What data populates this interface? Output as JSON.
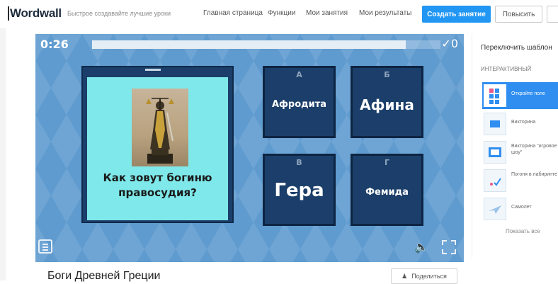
{
  "header": {
    "logo": "Wordwall",
    "tagline": "Быстрое создавайте лучшие уроки",
    "nav": [
      "Главная страница",
      "Функции",
      "Мои занятия",
      "Мои результаты"
    ],
    "create_button": "Создать занятие",
    "upgrade_button": "Повысить"
  },
  "game": {
    "timer": "0:26",
    "score": "✓0",
    "progress_fraction": 0.9,
    "question": "Как зовут богиню правосудия?",
    "answers": [
      {
        "letter": "А",
        "text": "Афродита"
      },
      {
        "letter": "Б",
        "text": "Афина"
      },
      {
        "letter": "В",
        "text": "Гера"
      },
      {
        "letter": "Г",
        "text": "Фемида"
      }
    ],
    "sound_icon": "speaker-icon",
    "fullscreen_icon": "fullscreen-icon",
    "menu_icon": "menu-icon"
  },
  "panel": {
    "title": "Переключить шаблон",
    "section": "ИНТЕРАКТИВНЫЙ",
    "templates": [
      {
        "label": "Откройте поле",
        "active": true
      },
      {
        "label": "Викторина",
        "active": false
      },
      {
        "label": "Викторина \"игровое шоу\"",
        "active": false
      },
      {
        "label": "Погоня в лабиринте",
        "active": false
      },
      {
        "label": "Самолет",
        "active": false
      }
    ],
    "show_all": "Показать все"
  },
  "footer": {
    "activity_title": "Боги Древней Греции",
    "share_button": "Поделиться"
  },
  "colors": {
    "accent": "#2196f3",
    "game_bg": "#5f9bcf",
    "card": "#1b3f6a",
    "question_bg": "#7fe8ea"
  }
}
